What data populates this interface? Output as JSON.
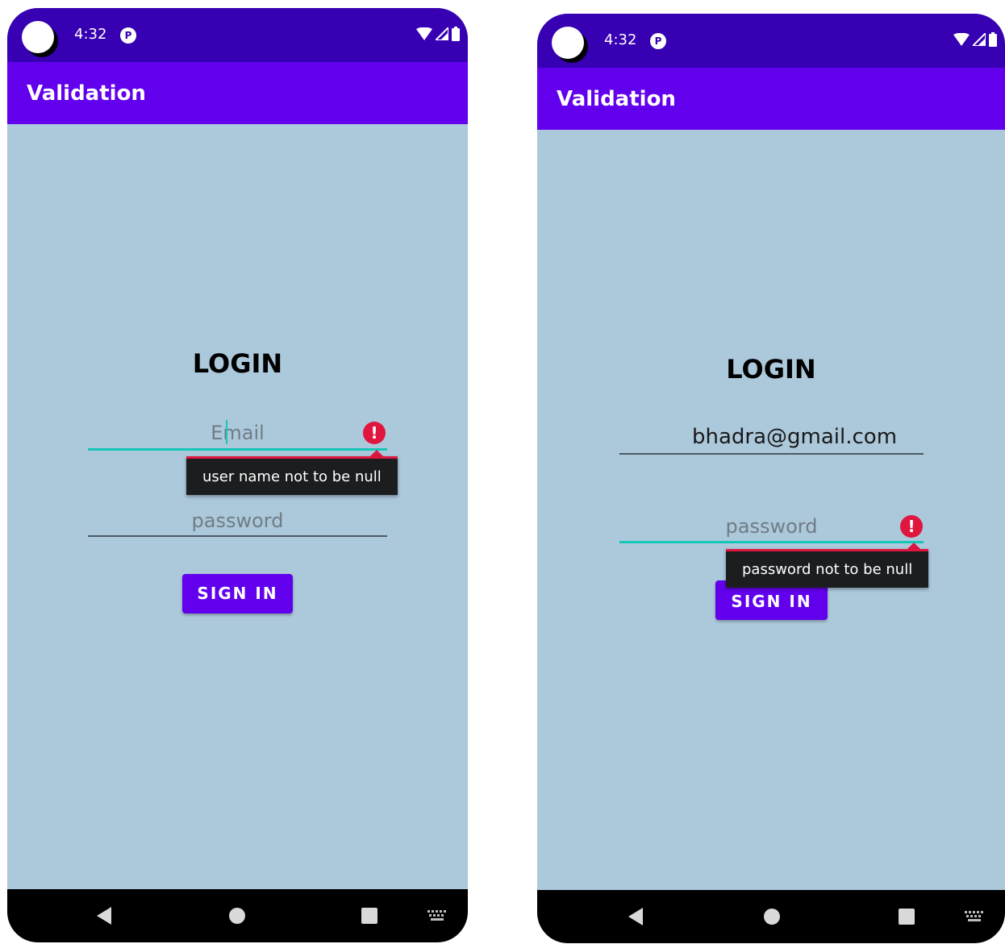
{
  "colors": {
    "status_bar": "#3700b3",
    "app_bar": "#6200ee",
    "background": "#acc8db",
    "button": "#6200ee",
    "focus_underline": "#16c7b6",
    "error": "#e0163f",
    "tooltip": "#1b1d1f",
    "nav_bar": "#000000"
  },
  "screens": [
    {
      "status": {
        "time": "4:32",
        "notification_icon": "pinned-notification-icon",
        "icons": [
          "wifi-icon",
          "signal-icon",
          "battery-icon"
        ]
      },
      "app_bar": {
        "title": "Validation"
      },
      "form": {
        "title": "LOGIN",
        "email": {
          "value": "",
          "placeholder": "Email",
          "focused": true,
          "error": "user name not to be null"
        },
        "password": {
          "value": "",
          "placeholder": "password",
          "focused": false,
          "error": ""
        },
        "sign_in_label": "SIGN IN"
      },
      "nav": [
        "back-icon",
        "home-icon",
        "recents-icon",
        "keyboard-icon"
      ]
    },
    {
      "status": {
        "time": "4:32",
        "notification_icon": "pinned-notification-icon",
        "icons": [
          "wifi-icon",
          "signal-icon",
          "battery-icon"
        ]
      },
      "app_bar": {
        "title": "Validation"
      },
      "form": {
        "title": "LOGIN",
        "email": {
          "value": "bhadra@gmail.com",
          "placeholder": "",
          "focused": false,
          "error": ""
        },
        "password": {
          "value": "",
          "placeholder": "password",
          "focused": true,
          "error": "password not to be null"
        },
        "sign_in_label": "SIGN IN"
      },
      "nav": [
        "back-icon",
        "home-icon",
        "recents-icon",
        "keyboard-icon"
      ]
    }
  ]
}
